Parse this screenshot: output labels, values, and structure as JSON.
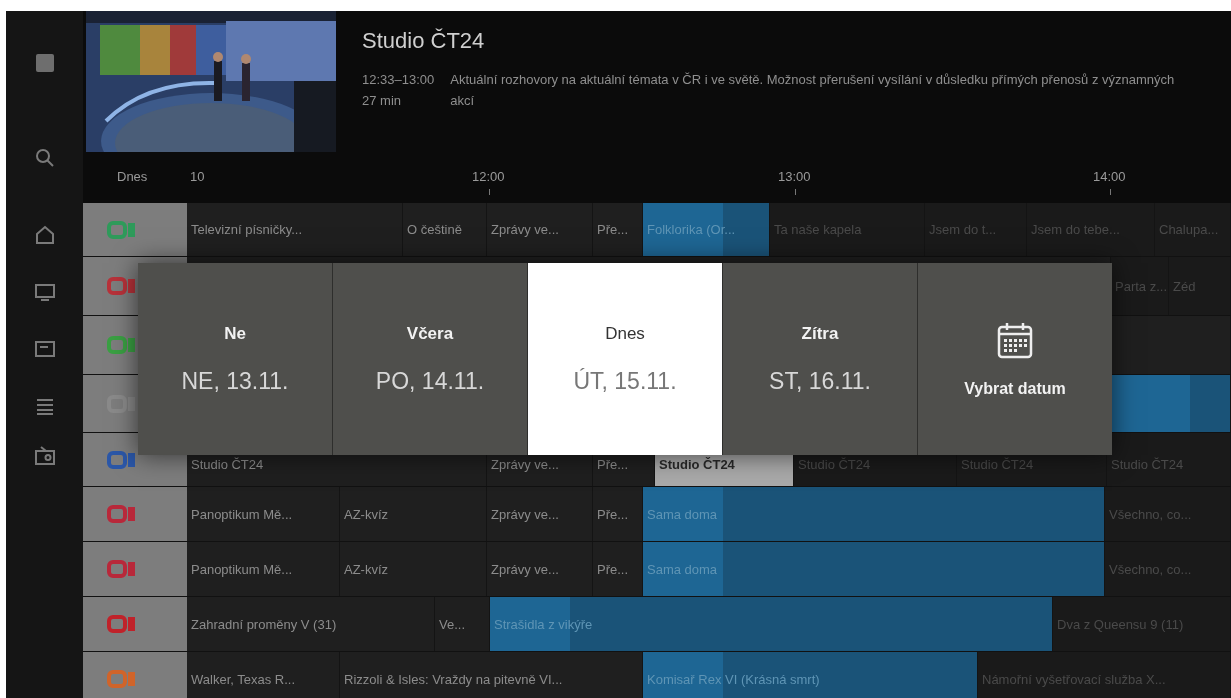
{
  "now_playing": {
    "title": "Studio ČT24",
    "time": "12:33–13:00",
    "duration": "27 min",
    "description": "Aktuální rozhovory na aktuální témata v ČR i ve světě. Možnost přerušení vysílání v důsledku přímých přenosů z významných akcí"
  },
  "timeline": {
    "day": "Dnes",
    "labels": [
      "10",
      "12:00",
      "13:00",
      "14:00"
    ]
  },
  "guide": {
    "rows": [
      {
        "programs": [
          {
            "title": "Televizní písničky...",
            "ended": true,
            "on_air": false,
            "selected": false
          },
          {
            "title": "O češtině",
            "ended": true,
            "on_air": false,
            "selected": false
          },
          {
            "title": "Zprávy ve...",
            "ended": true,
            "on_air": false,
            "selected": false
          },
          {
            "title": "Pře...",
            "ended": true,
            "on_air": false,
            "selected": false
          },
          {
            "title": "Folklorika (Or...",
            "ended": false,
            "on_air": true,
            "selected": false
          },
          {
            "title": "Ta naše kapela",
            "ended": false,
            "on_air": false,
            "selected": false
          },
          {
            "title": "Jsem do t...",
            "ended": false,
            "on_air": false,
            "selected": false
          },
          {
            "title": "Jsem do tebe...",
            "ended": false,
            "on_air": false,
            "selected": false
          },
          {
            "title": "Chalupa...",
            "ended": false,
            "on_air": false,
            "selected": false
          }
        ]
      },
      {
        "programs": [
          {
            "title": "Parta z...",
            "ended": false,
            "on_air": false,
            "selected": false
          },
          {
            "title": "Zéd",
            "ended": false,
            "on_air": false,
            "selected": false
          }
        ]
      },
      {},
      {
        "programs": [
          {
            "on_air": true,
            "selected": false
          }
        ]
      },
      {
        "programs": [
          {
            "title": "Studio ČT24",
            "ended": true,
            "on_air": false,
            "selected": false
          },
          {
            "title": "Zprávy ve...",
            "ended": true,
            "on_air": false,
            "selected": false
          },
          {
            "title": "Pře...",
            "ended": true,
            "on_air": false,
            "selected": false
          },
          {
            "title": "Studio ČT24",
            "ended": false,
            "on_air": false,
            "selected": true
          },
          {
            "title": "Studio ČT24",
            "ended": false,
            "on_air": false,
            "selected": false
          },
          {
            "title": "Studio ČT24",
            "ended": false,
            "on_air": false,
            "selected": false
          },
          {
            "title": "Studio ČT24",
            "ended": false,
            "on_air": false,
            "selected": false
          }
        ]
      },
      {
        "programs": [
          {
            "title": "Panoptikum Mě...",
            "ended": true,
            "on_air": false,
            "selected": false
          },
          {
            "title": "AZ-kvíz",
            "ended": true,
            "on_air": false,
            "selected": false
          },
          {
            "title": "Zprávy ve...",
            "ended": true,
            "on_air": false,
            "selected": false
          },
          {
            "title": "Pře...",
            "ended": true,
            "on_air": false,
            "selected": false
          },
          {
            "title": "Sama doma",
            "ended": false,
            "on_air": true,
            "selected": false
          },
          {
            "title": "Všechno, co...",
            "ended": false,
            "on_air": false,
            "selected": false
          }
        ]
      },
      {
        "programs": [
          {
            "title": "Panoptikum Mě...",
            "ended": true,
            "on_air": false,
            "selected": false
          },
          {
            "title": "AZ-kvíz",
            "ended": true,
            "on_air": false,
            "selected": false
          },
          {
            "title": "Zprávy ve...",
            "ended": true,
            "on_air": false,
            "selected": false
          },
          {
            "title": "Pře...",
            "ended": true,
            "on_air": false,
            "selected": false
          },
          {
            "title": "Sama doma",
            "ended": false,
            "on_air": true,
            "selected": false
          },
          {
            "title": "Všechno, co...",
            "ended": false,
            "on_air": false,
            "selected": false
          }
        ]
      },
      {
        "programs": [
          {
            "title": "Zahradní proměny V (31)",
            "ended": true,
            "on_air": false,
            "selected": false
          },
          {
            "title": "Ve...",
            "ended": true,
            "on_air": false,
            "selected": false
          },
          {
            "title": "Strašidla z vikýře",
            "ended": false,
            "on_air": true,
            "selected": false
          },
          {
            "title": "Dva z Queensu 9 (11)",
            "ended": false,
            "on_air": false,
            "selected": false
          }
        ]
      },
      {
        "programs": [
          {
            "title": "Walker, Texas R...",
            "ended": true,
            "on_air": false,
            "selected": false
          },
          {
            "title": "Rizzoli & Isles: Vraždy na pitevně VI...",
            "ended": true,
            "on_air": false,
            "selected": false
          },
          {
            "title": "Komisař Rex VI (Krásná smrt)",
            "ended": false,
            "on_air": true,
            "selected": false
          },
          {
            "title": "Námořní vyšetřovací služba X...",
            "ended": false,
            "on_air": false,
            "selected": false
          }
        ]
      }
    ]
  },
  "date_picker": {
    "options": [
      {
        "label": "Ne",
        "date": "NE, 13.11.",
        "selected": false
      },
      {
        "label": "Včera",
        "date": "PO, 14.11.",
        "selected": false
      },
      {
        "label": "Dnes",
        "date": "ÚT, 15.11.",
        "selected": true
      },
      {
        "label": "Zítra",
        "date": "ST, 16.11.",
        "selected": false
      }
    ],
    "custom": {
      "label": "Vybrat datum"
    }
  }
}
